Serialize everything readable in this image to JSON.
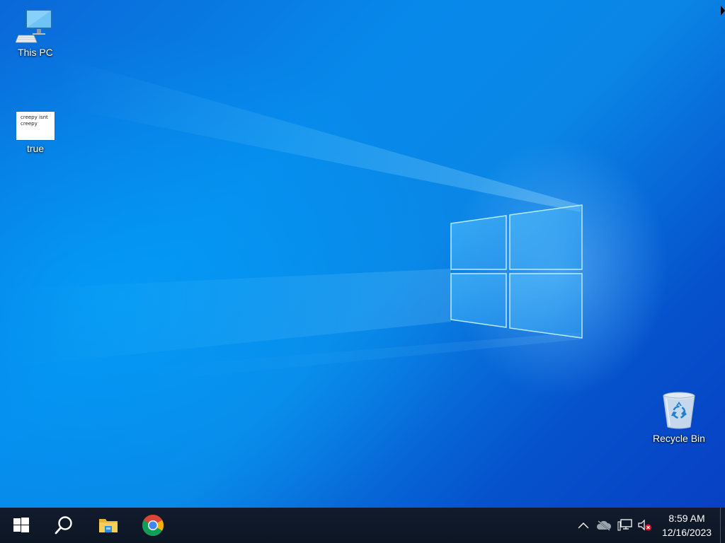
{
  "desktop": {
    "icons": [
      {
        "label": "This PC",
        "icon": "this-pc-icon"
      },
      {
        "label": "true",
        "icon": "text-document-icon",
        "thumbnail_text": "creepy isnt\ncreepy"
      },
      {
        "label": "Recycle Bin",
        "icon": "recycle-bin-icon"
      }
    ]
  },
  "taskbar": {
    "start": {
      "icon": "windows-logo-icon"
    },
    "search": {
      "icon": "search-icon"
    },
    "pinned": [
      {
        "name": "File Explorer",
        "icon": "folder-icon"
      },
      {
        "name": "Google Chrome",
        "icon": "chrome-icon"
      }
    ],
    "tray": {
      "icons": [
        "chevron-up-icon",
        "onedrive-cloud-icon",
        "network-icon",
        "volume-muted-icon"
      ],
      "time": "8:59 AM",
      "date": "12/16/2023"
    }
  },
  "colors": {
    "taskbar": "#0f1a2b",
    "wallpaper_blue": "#0a78e0",
    "text": "#ffffff"
  }
}
